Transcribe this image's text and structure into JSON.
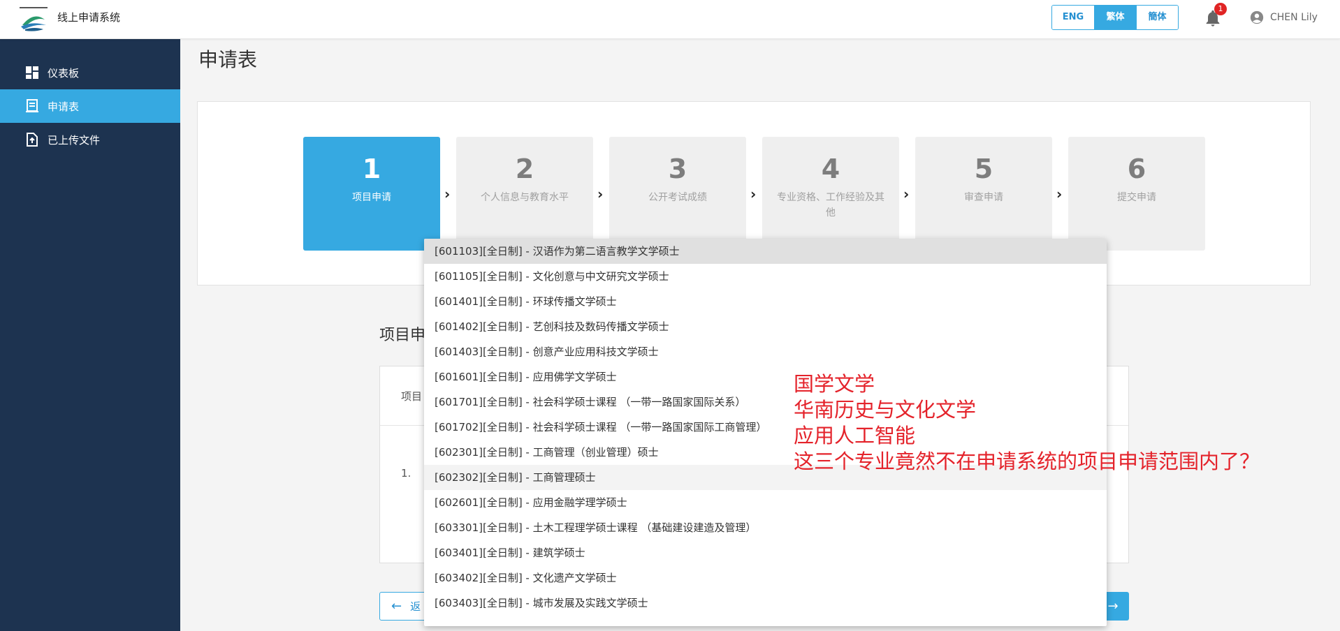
{
  "header": {
    "app_title": "线上申请系统",
    "languages": [
      {
        "label": "ENG",
        "active": false
      },
      {
        "label": "繁体",
        "active": true
      },
      {
        "label": "簡体",
        "active": false
      }
    ],
    "notification_count": "1",
    "user_name": "CHEN Lily"
  },
  "sidebar": {
    "items": [
      {
        "label": "仪表板",
        "icon": "dashboard-icon",
        "active": false
      },
      {
        "label": "申请表",
        "icon": "form-icon",
        "active": true
      },
      {
        "label": "已上传文件",
        "icon": "upload-file-icon",
        "active": false
      }
    ]
  },
  "main": {
    "page_title": "申请表",
    "steps": [
      {
        "num": "1",
        "label": "项目申请",
        "active": true
      },
      {
        "num": "2",
        "label": "个人信息与教育水平",
        "active": false
      },
      {
        "num": "3",
        "label": "公开考试成绩",
        "active": false
      },
      {
        "num": "4",
        "label": "专业资格、工作经验及其他",
        "active": false
      },
      {
        "num": "5",
        "label": "审查申请",
        "active": false
      },
      {
        "num": "6",
        "label": "提交申请",
        "active": false
      }
    ],
    "section_heading_visible": "项目申",
    "table_header_visible": "项目",
    "row_number": "1.",
    "back_button_visible": "返"
  },
  "dropdown": {
    "options": [
      "[601103][全日制] - 汉语作为第二语言教学文学硕士",
      "[601105][全日制] - 文化创意与中文研究文学硕士",
      "[601401][全日制] - 环球传播文学硕士",
      "[601402][全日制] - 艺创科技及数码传播文学硕士",
      "[601403][全日制] - 创意产业应用科技文学硕士",
      "[601601][全日制] - 应用佛学文学硕士",
      "[601701][全日制] - 社会科学硕士课程 （一带一路国家国际关系）",
      "[601702][全日制] - 社会科学硕士课程 （一带一路国家国际工商管理）",
      "[602301][全日制] - 工商管理（创业管理）硕士",
      "[602302][全日制] - 工商管理硕士",
      "[602601][全日制] - 应用金融学理学硕士",
      "[603301][全日制] - 土木工程理学硕士课程 （基础建设建造及管理）",
      "[603401][全日制] - 建筑学硕士",
      "[603402][全日制] - 文化遗产文学硕士",
      "[603403][全日制] - 城市发展及实践文学硕士"
    ],
    "selected_index": 0,
    "hover_index": 9
  },
  "annotation": {
    "lines": [
      "国学文学",
      "华南历史与文化文学",
      "应用人工智能",
      "这三个专业竟然不在申请系统的项目申请范围内了？"
    ],
    "color": "#e4232b"
  },
  "colors": {
    "accent": "#36a9e1",
    "sidebar_bg": "#1d3350"
  }
}
